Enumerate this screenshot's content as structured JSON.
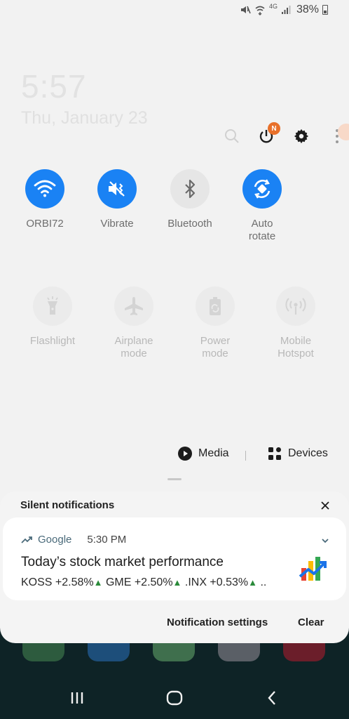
{
  "status_bar": {
    "network": "4G",
    "battery": "38%",
    "icons": [
      "mute-icon",
      "wifi-call-icon",
      "signal-icon",
      "battery-icon"
    ]
  },
  "clock": {
    "time": "5:57",
    "date": "Thu, January 23"
  },
  "top_actions": {
    "icons": [
      "search-icon",
      "power-icon",
      "settings-icon",
      "more-icon"
    ],
    "power_badge": "N"
  },
  "quick_settings": {
    "row1": [
      {
        "label": "ORBI72",
        "icon": "wifi-icon",
        "state": "on"
      },
      {
        "label": "Vibrate",
        "icon": "vibrate-icon",
        "state": "on"
      },
      {
        "label": "Bluetooth",
        "icon": "bluetooth-icon",
        "state": "off"
      },
      {
        "label_line1": "Auto",
        "label_line2": "rotate",
        "icon": "auto-rotate-icon",
        "state": "on"
      }
    ],
    "row2": [
      {
        "label": "Flashlight",
        "icon": "flashlight-icon",
        "state": "dim"
      },
      {
        "label_line1": "Airplane",
        "label_line2": "mode",
        "icon": "airplane-icon",
        "state": "dim"
      },
      {
        "label_line1": "Power",
        "label_line2": "mode",
        "icon": "power-mode-icon",
        "state": "dim"
      },
      {
        "label_line1": "Mobile",
        "label_line2": "Hotspot",
        "icon": "hotspot-icon",
        "state": "dim"
      }
    ]
  },
  "media_devices": {
    "media_label": "Media",
    "devices_label": "Devices"
  },
  "notifications": {
    "section_title": "Silent notifications",
    "item": {
      "app": "Google",
      "time": "5:30 PM",
      "title": "Today’s stock market performance",
      "stocks": [
        {
          "text": "KOSS +2.58%"
        },
        {
          "text": " GME +2.50%"
        },
        {
          "text": " .INX +0.53%"
        }
      ],
      "ellipsis": " .."
    },
    "settings_label": "Notification settings",
    "clear_label": "Clear"
  },
  "colors": {
    "accent": "#1a82f4",
    "badge": "#e8702a",
    "stock_up": "#2a8a3a",
    "panel_bg": "#f2f2f2"
  },
  "nav": {
    "icons": [
      "recents-icon",
      "home-icon",
      "back-icon"
    ]
  }
}
